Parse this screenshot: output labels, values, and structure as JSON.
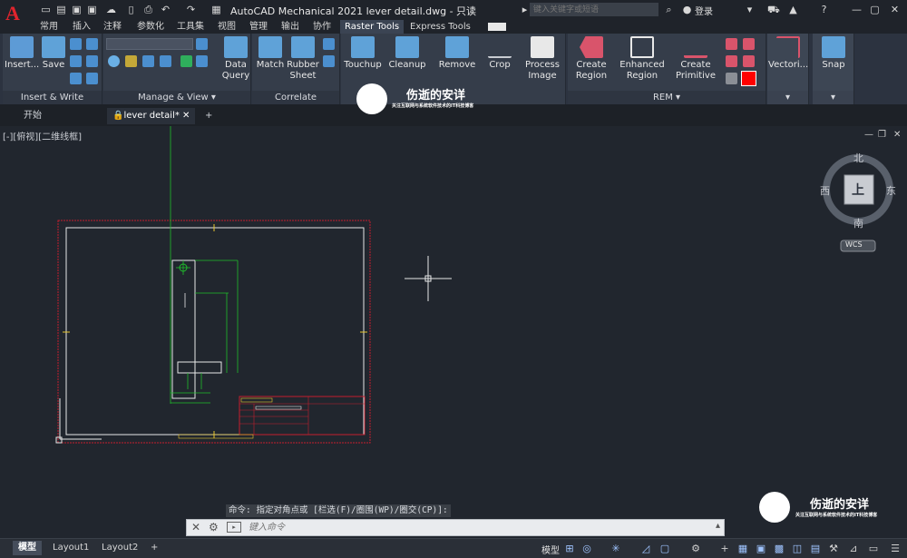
{
  "app": {
    "logo_letter": "A",
    "logo_sub": "M",
    "window_title": "AutoCAD Mechanical 2021    lever detail.dwg - 只读",
    "search_placeholder": "键入关键字或短语",
    "login_label": "登录"
  },
  "menu_tabs": [
    "常用",
    "插入",
    "注释",
    "参数化",
    "工具集",
    "视图",
    "管理",
    "输出",
    "协作",
    "Raster Tools",
    "Express Tools"
  ],
  "active_menu_tab": "Raster Tools",
  "ribbon": {
    "insert_write": {
      "label": "Insert & Write",
      "insert": "Insert...",
      "save": "Save"
    },
    "manage_view": {
      "label": "Manage & View",
      "data_query": "Data\nQuery"
    },
    "correlate": {
      "label": "Correlate",
      "match": "Match",
      "rubber_sheet": "Rubber\nSheet"
    },
    "edit": {
      "touchup": "Touchup",
      "cleanup": "Cleanup",
      "remove": "Remove",
      "crop": "Crop",
      "process_image": "Process\nImage"
    },
    "rem": {
      "label": "REM",
      "create_region": "Create\nRegion",
      "enhanced_region": "Enhanced\nRegion",
      "create_primitive": "Create\nPrimitive"
    },
    "vectorize": {
      "label": "Vectori..."
    },
    "snap": {
      "label": "Snap"
    }
  },
  "file_tabs": {
    "start": "开始",
    "doc": "lever detail*"
  },
  "viewport": {
    "view_label": "[-][俯视][二维线框]",
    "compass": {
      "north": "北",
      "south": "南",
      "east": "东",
      "west": "西",
      "top": "上"
    },
    "wcs": "WCS"
  },
  "command": {
    "history": "命令: 指定对角点或 [栏选(F)/圈围(WP)/圈交(CP)]:",
    "placeholder": "键入命令"
  },
  "layout_tabs": [
    "模型",
    "Layout1",
    "Layout2"
  ],
  "status": {
    "model": "模型"
  },
  "watermark": {
    "title": "伤逝的安详",
    "subtitle": "关注互联网与系统软件技术的IT科技博客"
  },
  "colors": {
    "accent": "#3b4453",
    "border_red": "#c41e2d",
    "green": "#1fbf2b",
    "white_line": "#e8e8e8"
  }
}
